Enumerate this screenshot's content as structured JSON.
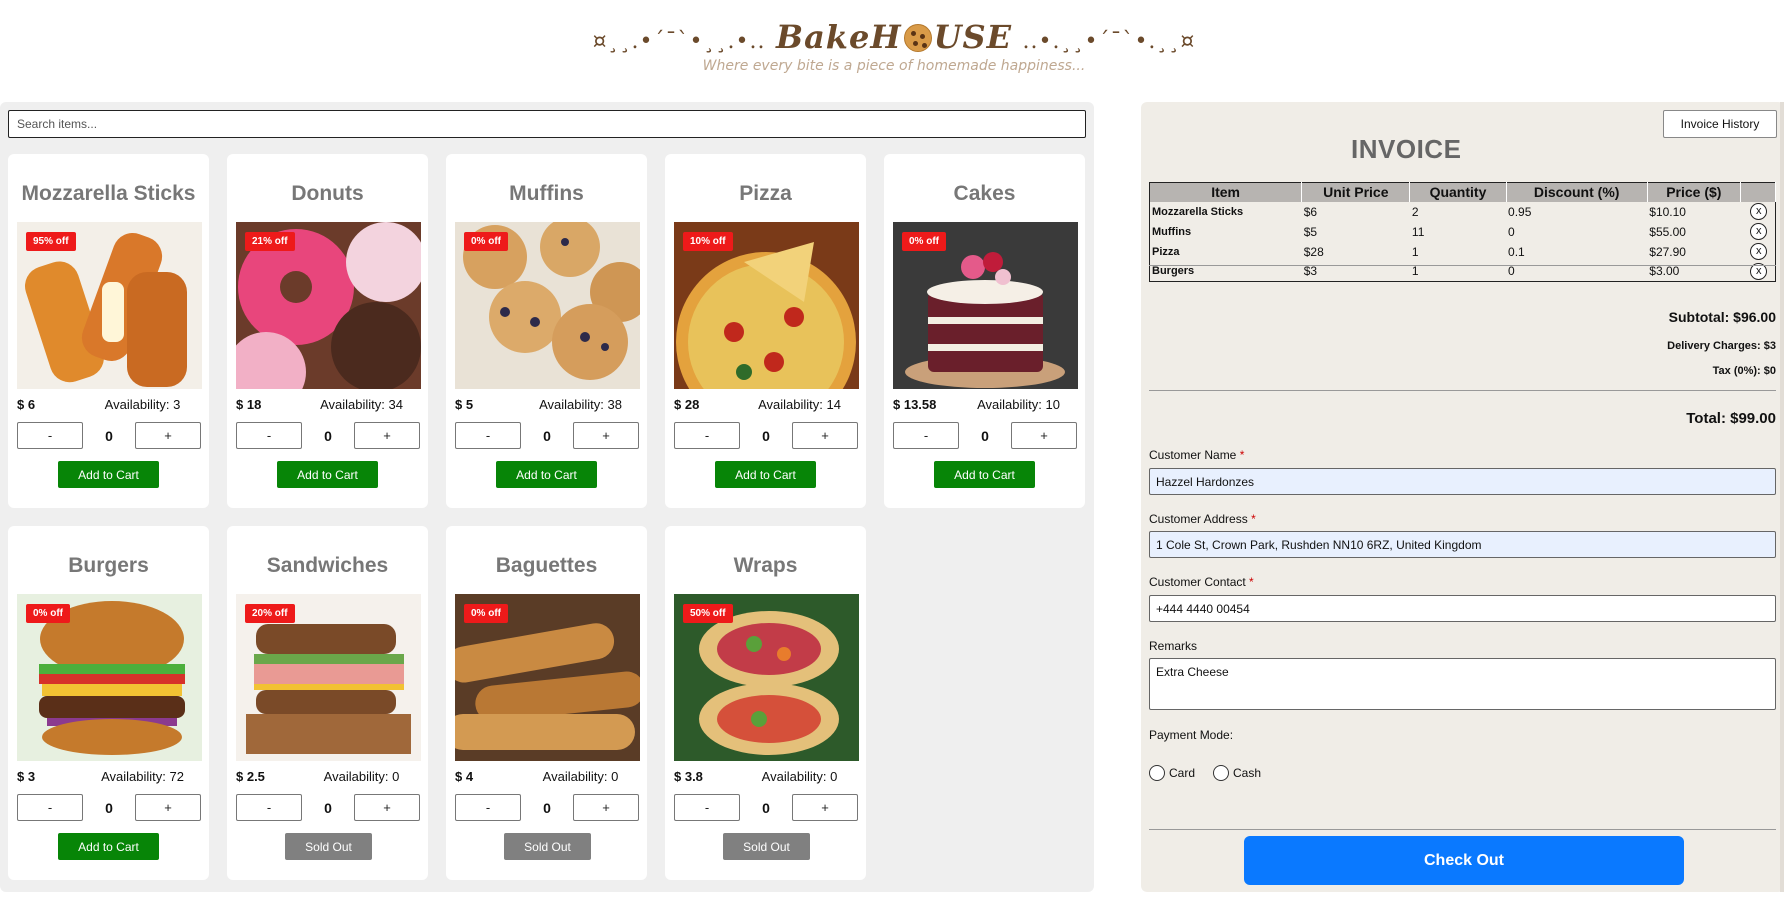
{
  "header": {
    "brand_left_deco": "¤¸¸.•´¯`•¸¸.•..",
    "brand_name_a": "BakeH",
    "brand_name_b": "USE",
    "brand_right_deco": "..•.¸¸•´¯`•.¸¸¤",
    "tagline": "Where every bite is a piece of homemade happiness..."
  },
  "search": {
    "placeholder": "Search items..."
  },
  "products": [
    {
      "name": "Mozzarella Sticks",
      "discount": "95% off",
      "price": "$ 6",
      "availability": "Availability: 3",
      "qty": "0",
      "minus": "-",
      "plus": "+",
      "action": "Add to Cart",
      "sold_out": false
    },
    {
      "name": "Donuts",
      "discount": "21% off",
      "price": "$ 18",
      "availability": "Availability: 34",
      "qty": "0",
      "minus": "-",
      "plus": "+",
      "action": "Add to Cart",
      "sold_out": false
    },
    {
      "name": "Muffins",
      "discount": "0% off",
      "price": "$ 5",
      "availability": "Availability: 38",
      "qty": "0",
      "minus": "-",
      "plus": "+",
      "action": "Add to Cart",
      "sold_out": false
    },
    {
      "name": "Pizza",
      "discount": "10% off",
      "price": "$ 28",
      "availability": "Availability: 14",
      "qty": "0",
      "minus": "-",
      "plus": "+",
      "action": "Add to Cart",
      "sold_out": false
    },
    {
      "name": "Cakes",
      "discount": "0% off",
      "price": "$ 13.58",
      "availability": "Availability: 10",
      "qty": "0",
      "minus": "-",
      "plus": "+",
      "action": "Add to Cart",
      "sold_out": false
    },
    {
      "name": "Burgers",
      "discount": "0% off",
      "price": "$ 3",
      "availability": "Availability: 72",
      "qty": "0",
      "minus": "-",
      "plus": "+",
      "action": "Add to Cart",
      "sold_out": false
    },
    {
      "name": "Sandwiches",
      "discount": "20% off",
      "price": "$ 2.5",
      "availability": "Availability: 0",
      "qty": "0",
      "minus": "-",
      "plus": "+",
      "action": "Sold Out",
      "sold_out": true
    },
    {
      "name": "Baguettes",
      "discount": "0% off",
      "price": "$ 4",
      "availability": "Availability: 0",
      "qty": "0",
      "minus": "-",
      "plus": "+",
      "action": "Sold Out",
      "sold_out": true
    },
    {
      "name": "Wraps",
      "discount": "50% off",
      "price": "$ 3.8",
      "availability": "Availability: 0",
      "qty": "0",
      "minus": "-",
      "plus": "+",
      "action": "Sold Out",
      "sold_out": true
    }
  ],
  "invoice": {
    "history_button": "Invoice History",
    "title": "INVOICE",
    "columns": [
      "Item",
      "Unit Price",
      "Quantity",
      "Discount (%)",
      "Price ($)"
    ],
    "rows": [
      {
        "item": "Mozzarella Sticks",
        "unit_price": "$6",
        "quantity": "2",
        "discount": "0.95",
        "price": "$10.10",
        "remove": "x"
      },
      {
        "item": "Muffins",
        "unit_price": "$5",
        "quantity": "11",
        "discount": "0",
        "price": "$55.00",
        "remove": "x"
      },
      {
        "item": "Pizza",
        "unit_price": "$28",
        "quantity": "1",
        "discount": "0.1",
        "price": "$27.90",
        "remove": "x"
      },
      {
        "item": "Burgers",
        "unit_price": "$3",
        "quantity": "1",
        "discount": "0",
        "price": "$3.00",
        "remove": "x"
      }
    ],
    "subtotal": "Subtotal: $96.00",
    "delivery": "Delivery Charges: $3",
    "tax": "Tax (0%): $0",
    "total": "Total: $99.00",
    "customer_name_label": "Customer Name",
    "customer_name": "Hazzel Hardonzes",
    "customer_address_label": "Customer Address",
    "customer_address": "1 Cole St, Crown Park, Rushden NN10 6RZ, United Kingdom",
    "customer_contact_label": "Customer Contact",
    "customer_contact": "+444 4440 00454",
    "remarks_label": "Remarks",
    "remarks": "Extra Cheese",
    "required_mark": "*",
    "payment_mode_label": "Payment Mode:",
    "payment_options": [
      "Card",
      "Cash"
    ],
    "checkout_button": "Check Out"
  },
  "colors": {
    "brand": "#6b4a2b",
    "discount_badge": "#ee1a1a",
    "add_to_cart": "#078507",
    "sold_out": "#808080",
    "checkout": "#0a79ff"
  }
}
